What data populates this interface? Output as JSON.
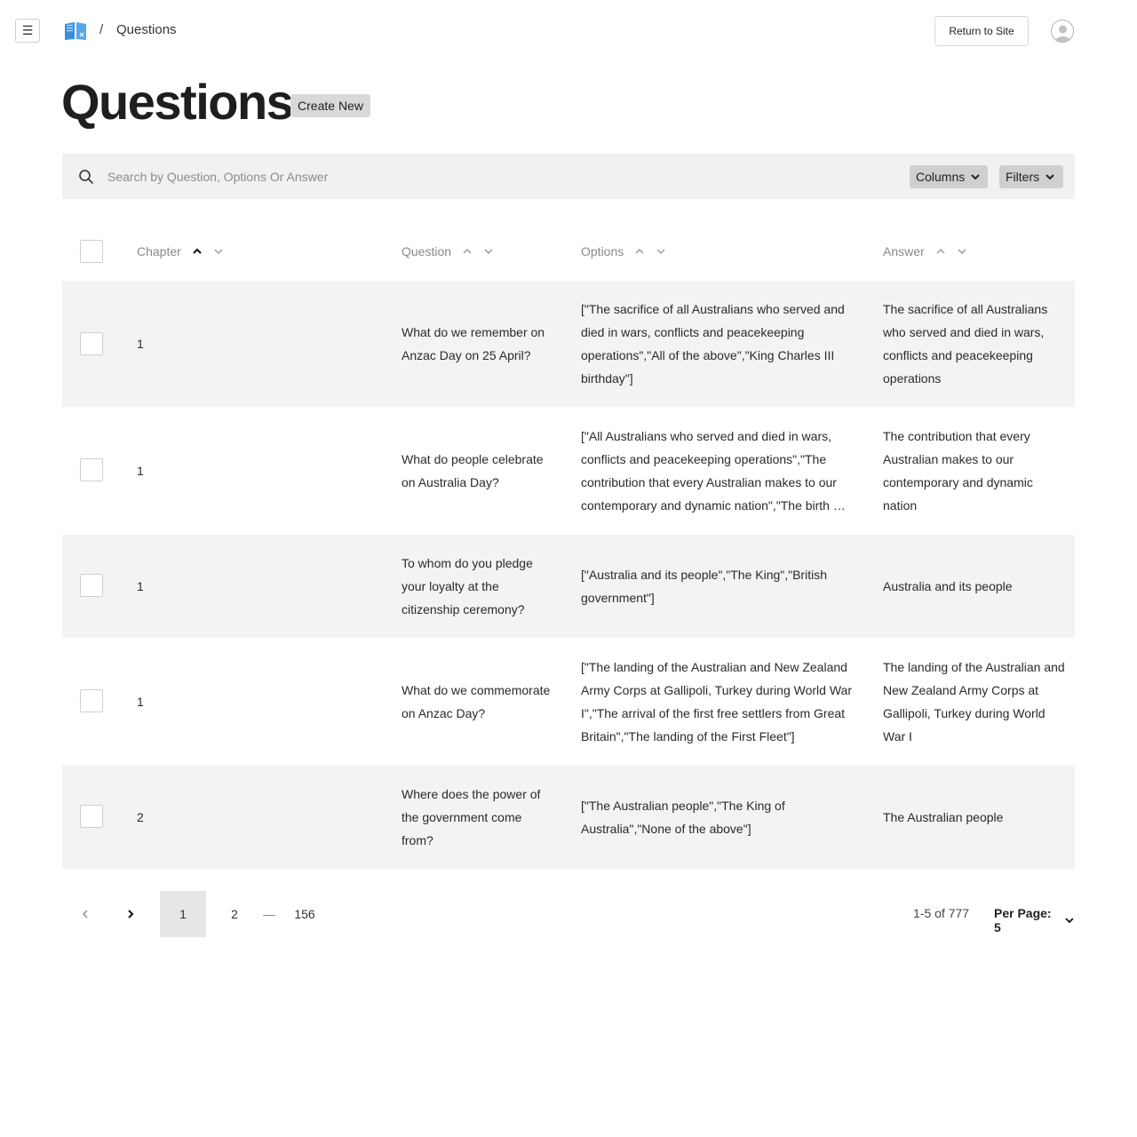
{
  "topbar": {
    "breadcrumb_separator": "/",
    "breadcrumb_current": "Questions",
    "return_label": "Return to Site"
  },
  "header": {
    "title": "Questions",
    "create_label": "Create New"
  },
  "search": {
    "placeholder": "Search by Question, Options Or Answer",
    "value": "",
    "columns_label": "Columns",
    "filters_label": "Filters"
  },
  "table": {
    "headers": {
      "chapter": "Chapter",
      "question": "Question",
      "options": "Options",
      "answer": "Answer"
    },
    "sorted_column": "chapter",
    "sorted_direction": "asc",
    "rows": [
      {
        "chapter": "1",
        "question": "What do we remember on Anzac Day on 25 April?",
        "options": "[\"The sacrifice of all Australians who served and died in wars, conflicts and peacekeeping operations\",\"All of the above\",\"King Charles III birthday\"]",
        "answer": "The sacrifice of all Australians who served and died in wars, conflicts and peacekeeping operations"
      },
      {
        "chapter": "1",
        "question": "What do people celebrate on Australia Day?",
        "options": "[\"All Australians who served and died in wars, conflicts and peacekeeping operations\",\"The contribution that every Australian makes to our contemporary and dynamic nation\",\"The birth of the Australian nation\"]",
        "answer": "The contribution that every Australian makes to our contemporary and dynamic nation"
      },
      {
        "chapter": "1",
        "question": "To whom do you pledge your loyalty at the citizenship ceremony?",
        "options": "[\"Australia and its people\",\"The King\",\"British government\"]",
        "answer": "Australia and its people"
      },
      {
        "chapter": "1",
        "question": "What do we commemorate on Anzac Day?",
        "options": "[\"The landing of the Australian and New Zealand Army Corps at Gallipoli, Turkey during World War I\",\"The arrival of the first free settlers from Great Britain\",\"The landing of the First Fleet\"]",
        "answer": "The landing of the Australian and New Zealand Army Corps at Gallipoli, Turkey during World War I"
      },
      {
        "chapter": "2",
        "question": "Where does the power of the government come from?",
        "options": "[\"The Australian people\",\"The King of Australia\",\"None of the above\"]",
        "answer": "The Australian people"
      }
    ]
  },
  "pagination": {
    "pages": [
      "1",
      "2"
    ],
    "ellipsis": "—",
    "last_page": "156",
    "current_page": "1",
    "range": "1-5 of 777",
    "per_page_label": "Per Page: 5"
  },
  "colors": {
    "row_shade": "#f3f3f3",
    "search_bg": "#f1f1f1",
    "button_grey": "#cfcfcf",
    "logo_blue": "#3b8fd9"
  }
}
